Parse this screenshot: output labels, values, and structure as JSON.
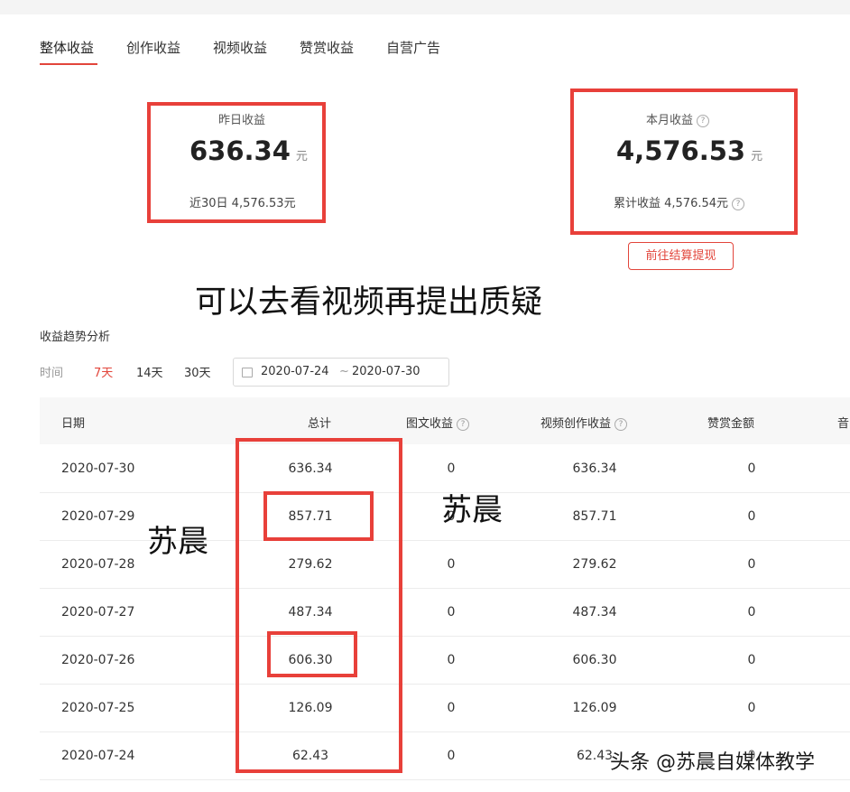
{
  "tabs": [
    "整体收益",
    "创作收益",
    "视频收益",
    "赞赏收益",
    "自营广告"
  ],
  "yesterday": {
    "title": "昨日收益",
    "value": "636.34",
    "unit": "元",
    "sub": "近30日 4,576.53元"
  },
  "month": {
    "title": "本月收益",
    "value": "4,576.53",
    "unit": "元",
    "sub": "累计收益 4,576.54元"
  },
  "withdraw_button": "前往结算提现",
  "overlay_caption": "可以去看视频再提出质疑",
  "overlay_name_left": "苏晨",
  "overlay_name_right": "苏晨",
  "trend": {
    "title": "收益趋势分析",
    "range_label": "时间",
    "ranges": [
      "7天",
      "14天",
      "30天"
    ],
    "date_start": "2020-07-24",
    "date_sep": "~",
    "date_end": "2020-07-30"
  },
  "table": {
    "headers": [
      "日期",
      "总计",
      "图文收益",
      "视频创作收益",
      "赞赏金额",
      "音"
    ],
    "rows": [
      {
        "date": "2020-07-30",
        "total": "636.34",
        "tw": "0",
        "video": "636.34",
        "tip": "0"
      },
      {
        "date": "2020-07-29",
        "total": "857.71",
        "tw": "0",
        "video": "857.71",
        "tip": "0"
      },
      {
        "date": "2020-07-28",
        "total": "279.62",
        "tw": "0",
        "video": "279.62",
        "tip": "0"
      },
      {
        "date": "2020-07-27",
        "total": "487.34",
        "tw": "0",
        "video": "487.34",
        "tip": "0"
      },
      {
        "date": "2020-07-26",
        "total": "606.30",
        "tw": "0",
        "video": "606.30",
        "tip": "0"
      },
      {
        "date": "2020-07-25",
        "total": "126.09",
        "tw": "0",
        "video": "126.09",
        "tip": "0"
      },
      {
        "date": "2020-07-24",
        "total": "62.43",
        "tw": "0",
        "video": "62.43",
        "tip": "0"
      }
    ]
  },
  "watermark": "头条 @苏晨自媒体教学",
  "colors": {
    "accent": "#e2453b",
    "annotation": "#e8403a"
  },
  "icons": [
    "help-icon",
    "calendar-icon"
  ]
}
